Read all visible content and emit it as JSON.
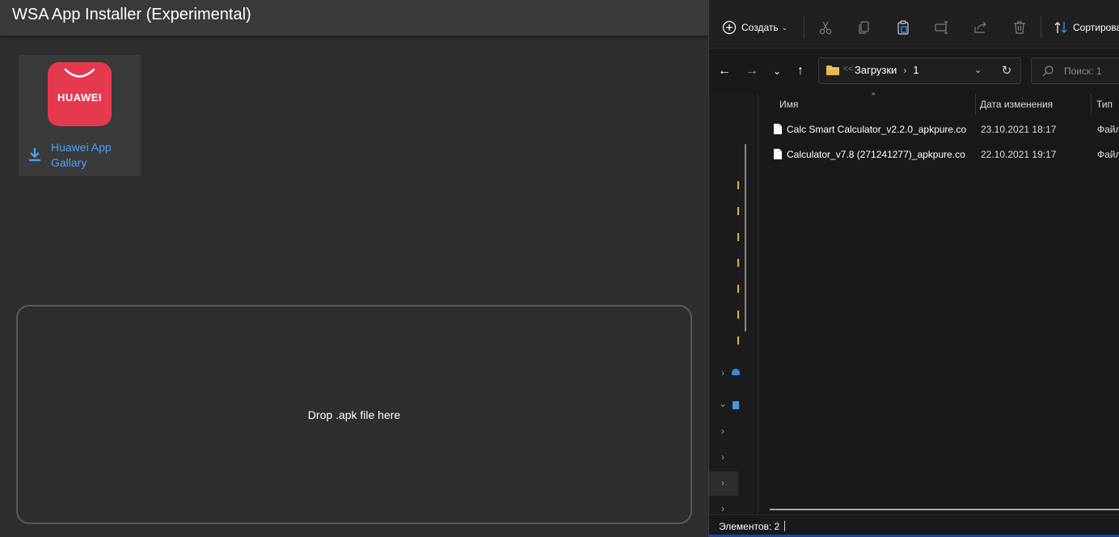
{
  "wsa": {
    "title": "WSA App Installer (Experimental)",
    "app_card": {
      "logo_text": "HUAWEI",
      "name": "Huawei App Gallary",
      "icon": "download-icon"
    },
    "drop_zone": {
      "label": "Drop .apk file here"
    },
    "colors": {
      "accent": "#4aa3ff",
      "logo_bg": "#e5394f"
    }
  },
  "explorer": {
    "toolbar": {
      "create_label": "Создать",
      "sort_label": "Сортировать",
      "icons": [
        "plus-circle-icon",
        "cut-icon",
        "copy-icon",
        "paste-icon",
        "rename-icon",
        "share-icon",
        "delete-icon",
        "sort-icon"
      ]
    },
    "address": {
      "path": [
        "Загрузки",
        "1"
      ],
      "overflow_glyph": "<<"
    },
    "search": {
      "placeholder": "Поиск: 1"
    },
    "columns": {
      "name": "Имя",
      "date": "Дата изменения",
      "type": "Тип"
    },
    "files": [
      {
        "name": "Calc Smart Calculator_v2.2.0_apkpure.co...",
        "date": "23.10.2021 18:17",
        "type": "Файл"
      },
      {
        "name": "Calculator_v7.8 (271241277)_apkpure.co...",
        "date": "22.10.2021 19:17",
        "type": "Файл"
      }
    ],
    "status": {
      "items_label": "Элементов: 2"
    }
  }
}
